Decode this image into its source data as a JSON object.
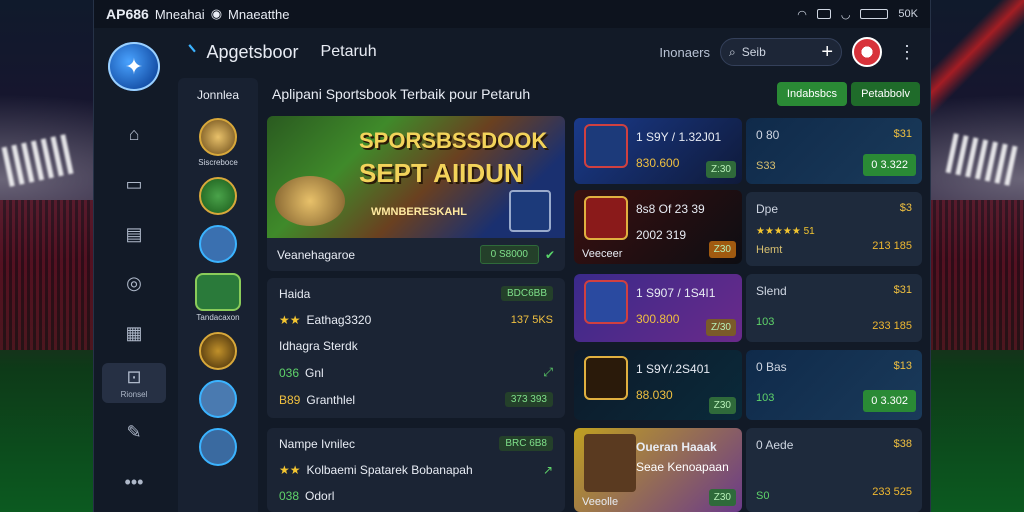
{
  "status": {
    "title": "AP686",
    "carrier": "Mneahai",
    "app": "Mnaeatthe",
    "battery": "50K"
  },
  "topbar": {
    "brand": "Apgetsboor",
    "section": "Petaruh",
    "label": "Inonaers",
    "search_placeholder": "Seib"
  },
  "rail": {
    "items": [
      {
        "icon": "home-icon",
        "label": ""
      },
      {
        "icon": "folder-icon",
        "label": ""
      },
      {
        "icon": "gift-icon",
        "label": ""
      },
      {
        "icon": "compass-icon",
        "label": ""
      },
      {
        "icon": "chart-icon",
        "label": ""
      },
      {
        "icon": "user-icon",
        "label": "Rionsel"
      },
      {
        "icon": "edit-icon",
        "label": ""
      },
      {
        "icon": "more-icon",
        "label": "•••"
      }
    ]
  },
  "sidebar": {
    "header": "Jonnlea",
    "items": [
      {
        "caption": "Siscreboce"
      },
      {
        "caption": ""
      },
      {
        "caption": ""
      },
      {
        "caption": "Tandacaxon"
      },
      {
        "caption": ""
      },
      {
        "caption": ""
      },
      {
        "caption": ""
      }
    ]
  },
  "main": {
    "heading": "Aplipani Sportsbook Terbaik pour Petaruh",
    "pills": [
      "Indabsbcs",
      "Petabbolv"
    ]
  },
  "hero": {
    "line1": "SPORSBSSDOOK",
    "line2": "SEPT AIIDUN",
    "line3": "WMNBERESKAHL",
    "footer": "Veanehagaroe",
    "odds": "0 S8000"
  },
  "cards": [
    {
      "title": "Haida",
      "title_badge": "BDC6BB",
      "line": "Eathag3320",
      "line_num": "137 5KS"
    },
    {
      "title": "Idhagra Sterdk",
      "stat1": "036",
      "stat2": "Gnl",
      "line": "Granthlel",
      "line_pre": "B89",
      "line_badge": "373 393"
    },
    {
      "title": "Nampe Ivnilec",
      "title_badge": "BRC 6B8",
      "line": "Kolbaemi Spatarek Bobanapah",
      "stat1": "038",
      "stat2": "Odorl"
    }
  ],
  "matches": [
    {
      "score": "1 S9Y / 1.32J01",
      "sub": "830.600",
      "tag": "Z:30"
    },
    {
      "score": "8s8 Of 23 39",
      "sub": "2002 319",
      "caption": "Veeceer",
      "tag": "Z30"
    },
    {
      "score": "1 S907 / 1S4I1",
      "sub": "300.800",
      "tag": "Z/30"
    },
    {
      "score": "1 S9Y/.2S401",
      "sub": "88.030",
      "tag": "Z30"
    },
    {
      "score": "Oueran Haaak",
      "sub": "Seae Kenoapaan",
      "caption": "Veeolle",
      "tag": "Z30"
    }
  ],
  "odds": [
    {
      "left": "0 80",
      "right": "$31",
      "bottom": "S33",
      "button": "0 3.322"
    },
    {
      "left": "Dpe",
      "right": "$3",
      "bottom": "Hemt",
      "rating": "★★★★★ 51",
      "value": "213 185"
    },
    {
      "left": "Slend",
      "right": "$31",
      "bottom": "103",
      "value": "233 185"
    },
    {
      "left": "0 Bas",
      "right": "$13",
      "bottom": "103",
      "button": "0 3.302"
    },
    {
      "left": "0 Aede",
      "right": "$38",
      "bottom": "S0",
      "value": "233 525"
    }
  ],
  "colors": {
    "accent": "#2a8a35",
    "gold": "#f0c040",
    "bg": "#121a27"
  }
}
